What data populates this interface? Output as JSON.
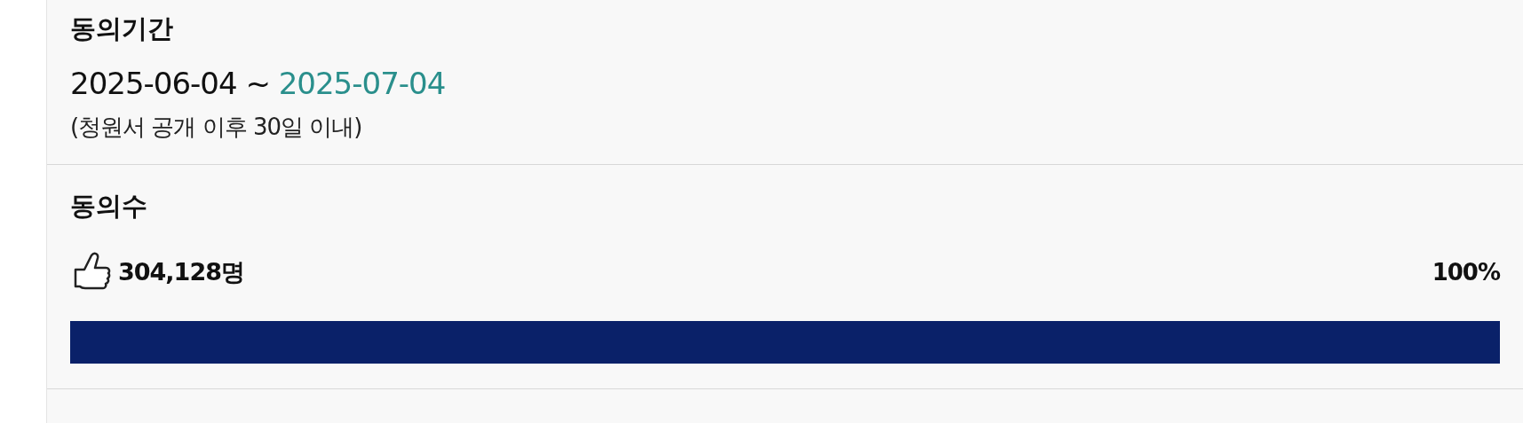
{
  "period": {
    "title": "동의기간",
    "start": "2025-06-04 ~",
    "end": "2025-07-04",
    "note": "(청원서 공개 이후 30일 이내)"
  },
  "agreements": {
    "title": "동의수",
    "count": "304,128명",
    "percent": "100%",
    "level": 1.0
  }
}
